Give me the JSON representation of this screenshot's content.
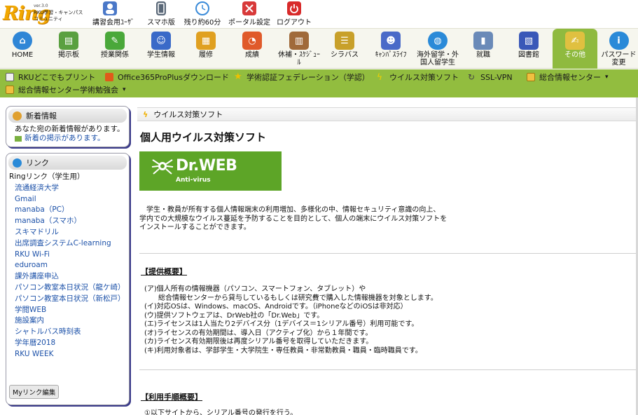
{
  "logo": {
    "text": "Ring",
    "version": "ver.3.0",
    "subtitle_line1": "RKU学習・キャンパス",
    "subtitle_line2": "コミュニティ"
  },
  "util_bar": [
    {
      "label": "講習会用ﾕｰｻﾞ",
      "icon": "user-icon",
      "color": "#4a78c8"
    },
    {
      "label": "スマホ版",
      "icon": "smartphone-icon",
      "color": "#5a6878"
    },
    {
      "label": "残り約60分",
      "icon": "clock-icon",
      "color": "#3a8ad8"
    },
    {
      "label": "ポータル設定",
      "icon": "tools-icon",
      "color": "#d83a3a"
    },
    {
      "label": "ログアウト",
      "icon": "power-icon",
      "color": "#d82a2a"
    }
  ],
  "main_nav": [
    {
      "label": "HOME",
      "icon": "home-icon",
      "color": "#2f86d6"
    },
    {
      "label": "掲示板",
      "icon": "board-icon",
      "color": "#5aa040"
    },
    {
      "label": "授業関係",
      "icon": "pencil-icon",
      "color": "#4aa83a"
    },
    {
      "label": "学生情報",
      "icon": "student-icon",
      "color": "#3a6ac8"
    },
    {
      "label": "履修",
      "icon": "notebook-icon",
      "color": "#e0a020"
    },
    {
      "label": "成績",
      "icon": "grades-icon",
      "color": "#e05a2a"
    },
    {
      "label": "休補・ｽｹｼﾞｭｰﾙ",
      "icon": "calendar-icon",
      "color": "#a06a3a"
    },
    {
      "label": "シラバス",
      "icon": "syllabus-icon",
      "color": "#c8a02a"
    },
    {
      "label": "ｷｬﾝﾊﾟｽﾗｲﾌ",
      "icon": "campus-life-icon",
      "color": "#4a6ac8"
    },
    {
      "label": "海外留学・外国人留学生",
      "icon": "globe-icon",
      "color": "#2a8ad8"
    },
    {
      "label": "就職",
      "icon": "building-icon",
      "color": "#6a8ab8"
    },
    {
      "label": "図書館",
      "icon": "library-icon",
      "color": "#3a58b8"
    },
    {
      "label": "その他",
      "icon": "other-icon",
      "color": "#e0c040"
    },
    {
      "label": "パスワード変更",
      "icon": "info-icon",
      "color": "#2a8ad8"
    }
  ],
  "active_nav": "その他",
  "sub_nav": [
    {
      "label": "RKUどこでもプリント",
      "icon": "printer-icon",
      "dropdown": false
    },
    {
      "label": "Office365ProPlusダウンロード",
      "icon": "office-icon",
      "dropdown": false
    },
    {
      "label": "学術認証フェデレーション（学認）",
      "icon": "star-icon",
      "dropdown": false
    },
    {
      "label": "ウイルス対策ソフト",
      "icon": "lightning-icon",
      "dropdown": false
    },
    {
      "label": "SSL-VPN",
      "icon": "sync-icon",
      "dropdown": false
    },
    {
      "label": "総合情報センター",
      "icon": "folder-icon",
      "dropdown": true
    },
    {
      "label": "総合情報センター学術勉強会",
      "icon": "folder-icon",
      "dropdown": true
    }
  ],
  "news_panel": {
    "title": "新着情報",
    "message": "あなた宛の新着情報があります。",
    "link": "新着の掲示があります。"
  },
  "links_panel": {
    "title": "リンク",
    "group_label": "Ringリンク（学生用）",
    "links": [
      "流通経済大学",
      "Gmail",
      "manaba（PC）",
      "manaba（スマホ）",
      "スキマドリル",
      "出席調査システムC-learning",
      "RKU Wi-Fi",
      "eduroam",
      "課外講座申込",
      "パソコン教室本日状況（龍ケ崎）",
      "パソコン教室本日状況（新松戸）",
      "学閲WEB",
      "施設案内",
      "シャトルバス時刻表",
      "学年暦2018",
      "RKU WEEK"
    ],
    "edit_button": "Myリンク編集"
  },
  "content": {
    "breadcrumb": "ウイルス対策ソフト",
    "title": "個人用ウイルス対策ソフト",
    "logo_brand": "Dr.WEB",
    "logo_sub": "Anti-virus",
    "intro": [
      "　学生・教員が所有する個人情報端末の利用増加、多様化の中、情報セキュリティ意識の向上、",
      "学内での大規模なウイルス蔓延を予防することを目的として、個人の端末にウイルス対策ソフトを",
      "インストールすることができます。"
    ],
    "section1_title": "【提供概要】",
    "section1_lines": [
      "(ア)個人所有の情報機器（パソコン、スマートフォン、タブレット）や",
      "　　総合情報センターから貸与しているもしくは研究費で購入した情報機器を対象とします。",
      "(イ)対応OSは、Windows、macOS、Androidです。（iPhoneなどのiOSは非対応）",
      "(ウ)提供ソフトウェアは、DrWeb社の「Dr.Web」です。",
      "(エ)ライセンスは1人当たり2デバイス分（1デバイス＝1シリアル番号）利用可能です。",
      "(オ)ライセンスの有効期間は、導入日（アクティブ化）から１年間です。",
      "(カ)ライセンス有効期限後は再度シリアル番号を取得していただきます。",
      "(キ)利用対象者は、学部学生・大学院生・専任教員・非常勤教員・職員・臨時職員です。"
    ],
    "section2_title": "【利用手順概要】",
    "section2_partial": "①以下サイトから、シリアル番号の発行を行う。"
  }
}
